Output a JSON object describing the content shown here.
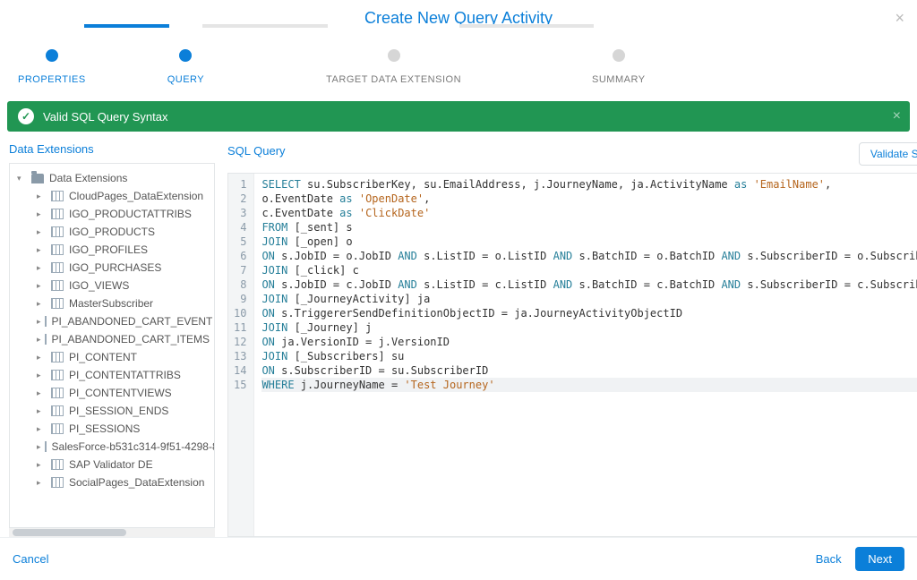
{
  "header": {
    "title": "Create New Query Activity"
  },
  "stepper": {
    "steps": [
      {
        "label": "PROPERTIES",
        "state": "done"
      },
      {
        "label": "QUERY",
        "state": "active"
      },
      {
        "label": "TARGET DATA EXTENSION",
        "state": "pending"
      },
      {
        "label": "SUMMARY",
        "state": "pending"
      }
    ]
  },
  "banner": {
    "text": "Valid SQL Query Syntax"
  },
  "left": {
    "title": "Data Extensions",
    "root": "Data Extensions",
    "items": [
      "CloudPages_DataExtension",
      "IGO_PRODUCTATTRIBS",
      "IGO_PRODUCTS",
      "IGO_PROFILES",
      "IGO_PURCHASES",
      "IGO_VIEWS",
      "MasterSubscriber",
      "PI_ABANDONED_CART_EVENT",
      "PI_ABANDONED_CART_ITEMS",
      "PI_CONTENT",
      "PI_CONTENTATTRIBS",
      "PI_CONTENTVIEWS",
      "PI_SESSION_ENDS",
      "PI_SESSIONS",
      "SalesForce-b531c314-9f51-4298-8",
      "SAP Validator DE",
      "SocialPages_DataExtension"
    ]
  },
  "right": {
    "title": "SQL Query",
    "validate": "Validate Syntax",
    "lines": [
      [
        [
          "kw",
          "SELECT"
        ],
        [
          "",
          " su.SubscriberKey, su.EmailAddress, j.JourneyName, ja.ActivityName "
        ],
        [
          "kw",
          "as"
        ],
        [
          "",
          " "
        ],
        [
          "str",
          "'EmailName'"
        ],
        [
          "",
          ","
        ]
      ],
      [
        [
          "",
          "o.EventDate "
        ],
        [
          "kw",
          "as"
        ],
        [
          "",
          " "
        ],
        [
          "str",
          "'OpenDate'"
        ],
        [
          "",
          ","
        ]
      ],
      [
        [
          "",
          "c.EventDate "
        ],
        [
          "kw",
          "as"
        ],
        [
          "",
          " "
        ],
        [
          "str",
          "'ClickDate'"
        ]
      ],
      [
        [
          "kw",
          "FROM"
        ],
        [
          "",
          " [_sent] s"
        ]
      ],
      [
        [
          "kw",
          "JOIN"
        ],
        [
          "",
          " [_open] o"
        ]
      ],
      [
        [
          "kw",
          "ON"
        ],
        [
          "",
          " s.JobID = o.JobID "
        ],
        [
          "kw",
          "AND"
        ],
        [
          "",
          " s.ListID = o.ListID "
        ],
        [
          "kw",
          "AND"
        ],
        [
          "",
          " s.BatchID = o.BatchID "
        ],
        [
          "kw",
          "AND"
        ],
        [
          "",
          " s.SubscriberID = o.SubscriberID"
        ]
      ],
      [
        [
          "kw",
          "JOIN"
        ],
        [
          "",
          " [_click] c"
        ]
      ],
      [
        [
          "kw",
          "ON"
        ],
        [
          "",
          " s.JobID = c.JobID "
        ],
        [
          "kw",
          "AND"
        ],
        [
          "",
          " s.ListID = c.ListID "
        ],
        [
          "kw",
          "AND"
        ],
        [
          "",
          " s.BatchID = c.BatchID "
        ],
        [
          "kw",
          "AND"
        ],
        [
          "",
          " s.SubscriberID = c.SubscriberID"
        ]
      ],
      [
        [
          "kw",
          "JOIN"
        ],
        [
          "",
          " [_JourneyActivity] ja"
        ]
      ],
      [
        [
          "kw",
          "ON"
        ],
        [
          "",
          " s.TriggererSendDefinitionObjectID = ja.JourneyActivityObjectID"
        ]
      ],
      [
        [
          "kw",
          "JOIN"
        ],
        [
          "",
          " [_Journey] j"
        ]
      ],
      [
        [
          "kw",
          "ON"
        ],
        [
          "",
          " ja.VersionID = j.VersionID"
        ]
      ],
      [
        [
          "kw",
          "JOIN"
        ],
        [
          "",
          " [_Subscribers] su"
        ]
      ],
      [
        [
          "kw",
          "ON"
        ],
        [
          "",
          " s.SubscriberID = su.SubscriberID"
        ]
      ],
      [
        [
          "kw",
          "WHERE"
        ],
        [
          "",
          " j.JourneyName = "
        ],
        [
          "str",
          "'Test Journey'"
        ]
      ]
    ],
    "currentLine": 15
  },
  "footer": {
    "cancel": "Cancel",
    "back": "Back",
    "next": "Next"
  }
}
